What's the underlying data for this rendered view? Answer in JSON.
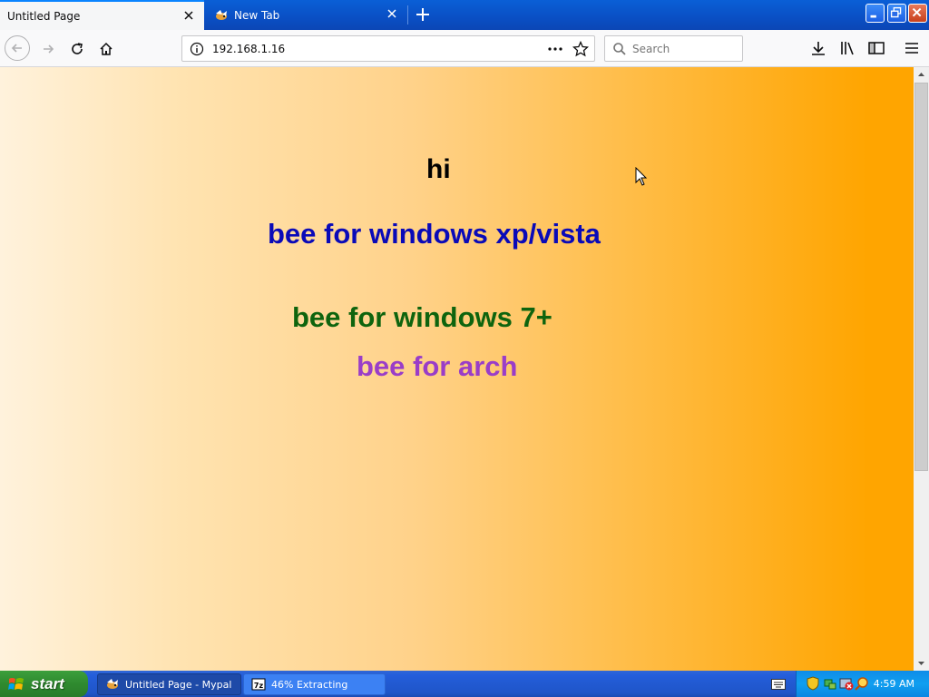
{
  "browser": {
    "tabs": [
      {
        "label": "Untitled Page",
        "active": true
      },
      {
        "label": "New Tab",
        "active": false
      }
    ],
    "url": "192.168.1.16",
    "search_placeholder": "Search"
  },
  "page": {
    "headings": [
      {
        "text": "hi",
        "color": "#000000"
      },
      {
        "text": "bee for windows xp/vista",
        "color": "#0a0ab8"
      },
      {
        "text": "bee for windows 7+",
        "color": "#0e640e"
      },
      {
        "text": "bee for arch",
        "color": "#9a3dc8"
      }
    ],
    "background_gradient": [
      "#fff2dc",
      "#ffa500"
    ]
  },
  "taskbar": {
    "start_label": "start",
    "tasks": [
      {
        "label": "Untitled Page - Mypal",
        "icon": "mypal-icon"
      },
      {
        "label": "46% Extracting",
        "icon": "7zip-icon"
      }
    ],
    "clock": "4:59 AM"
  }
}
